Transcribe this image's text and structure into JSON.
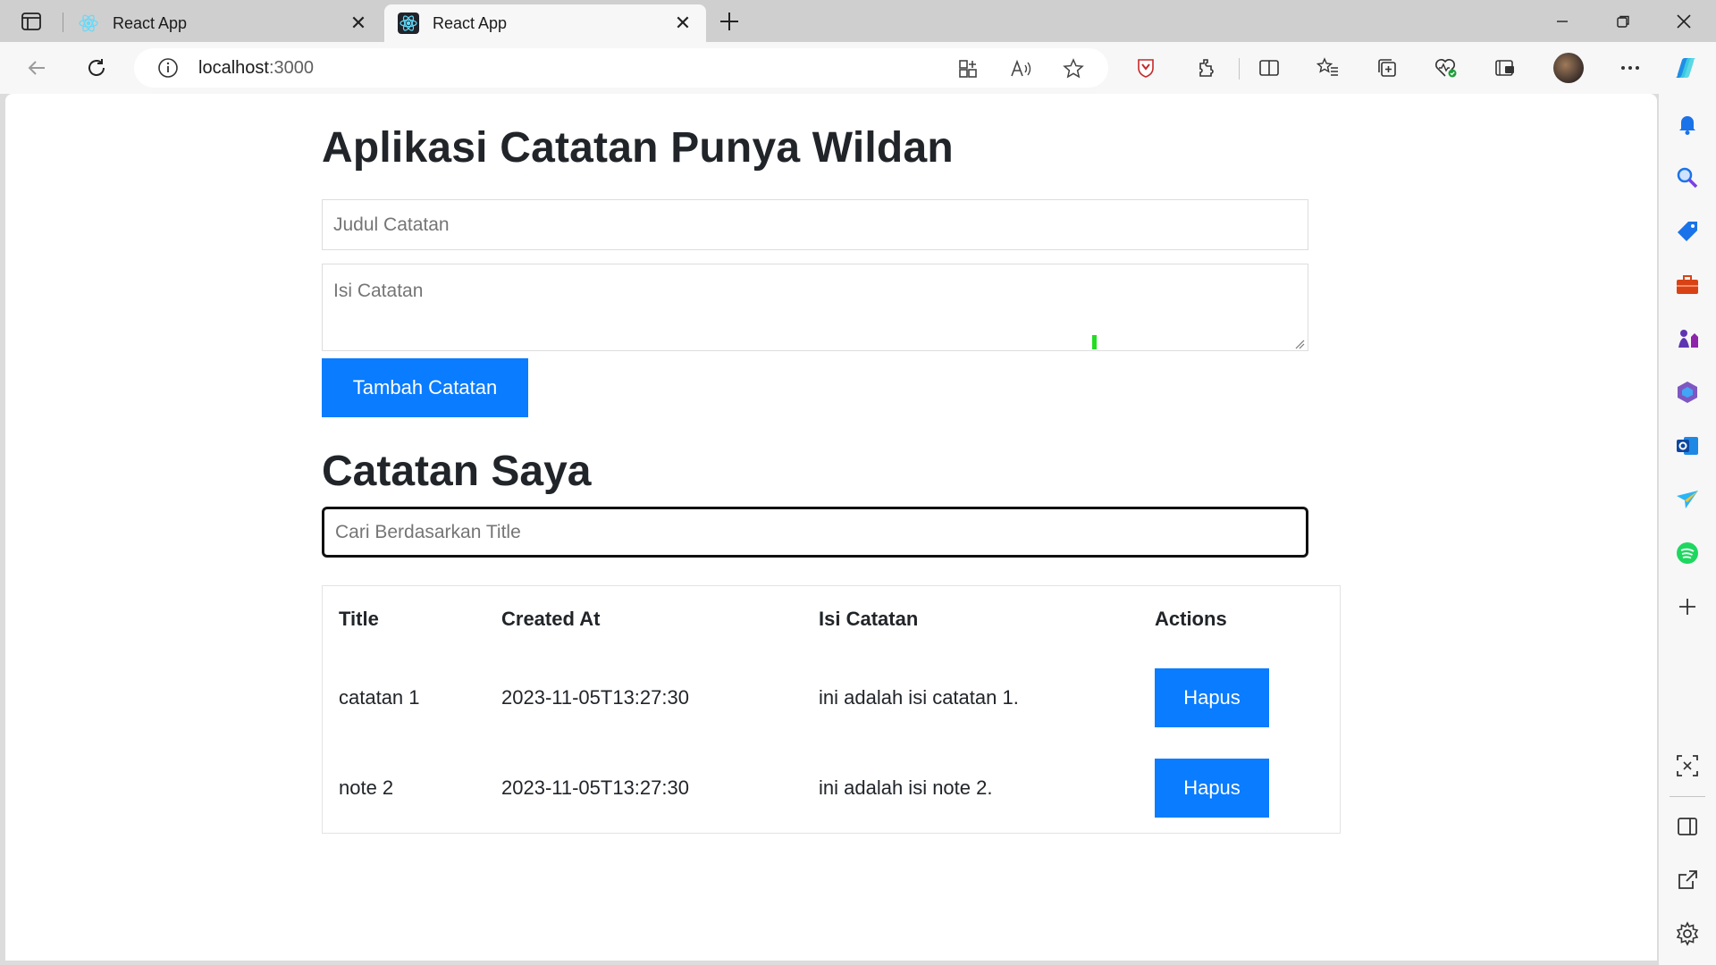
{
  "browser": {
    "tabs": [
      {
        "title": "React App",
        "active": false
      },
      {
        "title": "React App",
        "active": true
      }
    ],
    "address": {
      "host": "localhost",
      "port": ":3000"
    }
  },
  "page": {
    "title": "Aplikasi Catatan Punya Wildan",
    "form": {
      "title_placeholder": "Judul Catatan",
      "title_value": "",
      "body_placeholder": "Isi Catatan",
      "body_value": "",
      "submit_label": "Tambah Catatan"
    },
    "notes_heading": "Catatan Saya",
    "search": {
      "placeholder": "Cari Berdasarkan Title",
      "value": ""
    },
    "table": {
      "headers": [
        "Title",
        "Created At",
        "Isi Catatan",
        "Actions"
      ],
      "rows": [
        {
          "title": "catatan 1",
          "created_at": "2023-11-05T13:27:30",
          "body": "ini adalah isi catatan 1.",
          "action": "Hapus"
        },
        {
          "title": "note 2",
          "created_at": "2023-11-05T13:27:30",
          "body": "ini adalah isi note 2.",
          "action": "Hapus"
        }
      ]
    }
  },
  "colors": {
    "primary": "#0a7cff",
    "text": "#212529",
    "placeholder": "#6c757d"
  }
}
